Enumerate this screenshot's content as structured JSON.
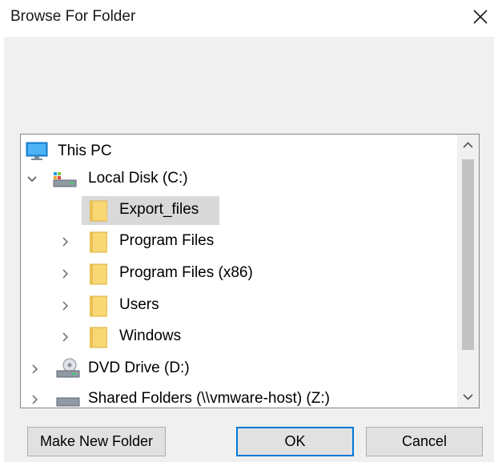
{
  "window": {
    "title": "Browse For Folder"
  },
  "tree": {
    "items": [
      {
        "label": "This PC",
        "icon": "computer-icon",
        "expander": "none"
      },
      {
        "label": "Local Disk (C:)",
        "icon": "drive-icon",
        "expander": "expanded"
      },
      {
        "label": "Export_files",
        "icon": "folder-icon",
        "expander": "none",
        "selected": true
      },
      {
        "label": "Program Files",
        "icon": "folder-icon",
        "expander": "collapsed"
      },
      {
        "label": "Program Files (x86)",
        "icon": "folder-icon",
        "expander": "collapsed"
      },
      {
        "label": "Users",
        "icon": "folder-icon",
        "expander": "collapsed"
      },
      {
        "label": "Windows",
        "icon": "folder-icon",
        "expander": "collapsed"
      },
      {
        "label": "DVD Drive (D:)",
        "icon": "dvd-drive-icon",
        "expander": "collapsed"
      },
      {
        "label": "Shared Folders (\\\\vmware-host) (Z:)",
        "icon": "network-drive-icon",
        "expander": "collapsed"
      }
    ]
  },
  "buttons": {
    "make_new_folder": "Make New Folder",
    "ok": "OK",
    "cancel": "Cancel"
  },
  "colors": {
    "selection": "#d9d9d9",
    "folder": "#f8d775",
    "focus_border": "#0078d7",
    "dialog_bg": "#f0f0f0"
  }
}
